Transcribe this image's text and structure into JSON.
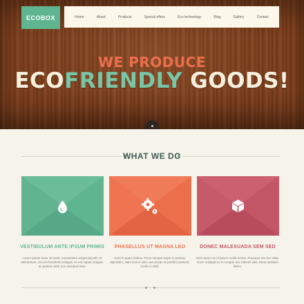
{
  "header": {
    "logo": "ECOBOX",
    "nav": [
      "Home",
      "About",
      "Products",
      "Special offers",
      "Eco technology",
      "Blog",
      "Gallery",
      "Contact"
    ]
  },
  "hero": {
    "subtitle": "WE PRODUCE",
    "title_part1": "ECO",
    "title_part2": "FRIENDLY ",
    "title_part3": "GOODS!"
  },
  "section": {
    "title": "WHAT WE DO"
  },
  "features": [
    {
      "icon": "water-drop-icon",
      "color": "#5fb58f",
      "title": "VESTIBULUM ANTE IPSUM PRIMIS",
      "text": "Lorem ipsum dolor sit amet, consectetur adipiscing elit. Ut elementum, nisi vel hendrerit volutpat, ex est sapien magna, ac pretium nibh non tincidunt ante."
    },
    {
      "icon": "gears-icon",
      "color": "#ec6f4c",
      "title": "PHASELLUS UT MAGNA LEO",
      "text": "Cras in quam finibus. Proin semper turpis in pretium dignissim. Nam lectus odio, accumsan at porttitor pretium, mollis in nibh."
    },
    {
      "icon": "box-icon",
      "color": "#c25566",
      "title": "DONEC MALESUADA SEM SED",
      "text": "Sed rutrum ex id ipsum mollis lectus. Praesent nec leo vitae. Nunc volutpat ex in congue nec ultrices velit. Etiam pretium libero."
    }
  ],
  "colors": {
    "accent_green": "#5fb58f",
    "accent_orange": "#ec6f4c",
    "accent_red": "#c25566",
    "background": "#f6f4ea"
  }
}
